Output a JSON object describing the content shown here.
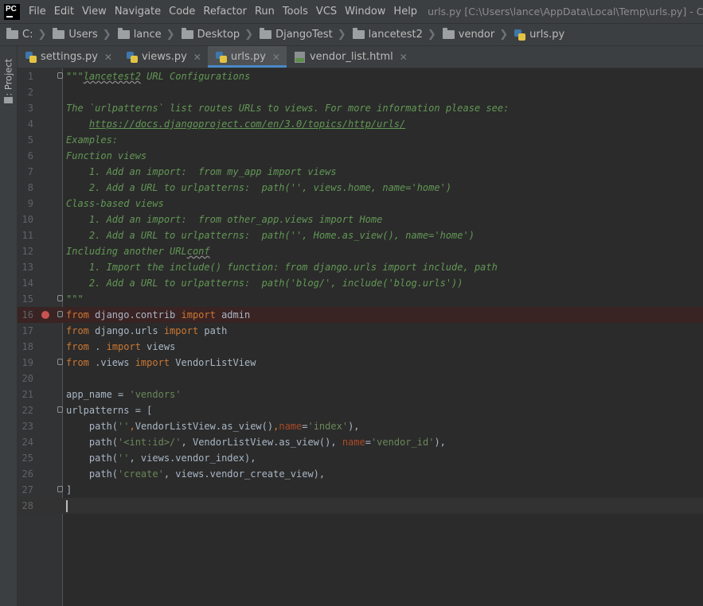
{
  "app": {
    "logo_text": "PC",
    "menu": [
      "File",
      "Edit",
      "View",
      "Navigate",
      "Code",
      "Refactor",
      "Run",
      "Tools",
      "VCS",
      "Window",
      "Help"
    ],
    "window_title": "urls.py [C:\\Users\\lance\\AppData\\Local\\Temp\\urls.py] - C:\\Users\\"
  },
  "breadcrumb": [
    "C:",
    "Users",
    "lance",
    "Desktop",
    "DjangoTest",
    "lancetest2",
    "vendor",
    "urls.py"
  ],
  "toolwindow": {
    "project_label": "1: Project"
  },
  "tabs": [
    {
      "label": "settings.py",
      "type": "py",
      "active": false
    },
    {
      "label": "views.py",
      "type": "py",
      "active": false
    },
    {
      "label": "urls.py",
      "type": "py",
      "active": true
    },
    {
      "label": "vendor_list.html",
      "type": "html",
      "active": false
    }
  ],
  "colors": {
    "keyword": "#cc7832",
    "string": "#6a8759",
    "docstring": "#629755",
    "param": "#aa4926",
    "breakpoint": "#c75450",
    "accent": "#4a88c7"
  },
  "editor": {
    "lines": [
      [
        {
          "t": "\"\"\"",
          "c": "doc"
        },
        {
          "t": "lancetest2",
          "c": "doc squig"
        },
        {
          "t": " URL Configurations",
          "c": "doc"
        }
      ],
      [],
      [
        {
          "t": "The `urlpatterns` list routes URLs to views. For more information please see:",
          "c": "doc"
        }
      ],
      [
        {
          "t": "    ",
          "c": "doc"
        },
        {
          "t": "https://docs.djangoproject.com/en/3.0/topics/http/urls/",
          "c": "doc link"
        }
      ],
      [
        {
          "t": "Examples:",
          "c": "doc"
        }
      ],
      [
        {
          "t": "Function views",
          "c": "doc"
        }
      ],
      [
        {
          "t": "    1. Add an import:  from my_app import views",
          "c": "doc"
        }
      ],
      [
        {
          "t": "    2. Add a URL to urlpatterns:  path('', views.home, name='home')",
          "c": "doc"
        }
      ],
      [
        {
          "t": "Class-based views",
          "c": "doc"
        }
      ],
      [
        {
          "t": "    1. Add an import:  from other_app.views import Home",
          "c": "doc"
        }
      ],
      [
        {
          "t": "    2. Add a URL to urlpatterns:  path('', Home.as_view(), name='home')",
          "c": "doc"
        }
      ],
      [
        {
          "t": "Including another URL",
          "c": "doc"
        },
        {
          "t": "conf",
          "c": "doc squig"
        }
      ],
      [
        {
          "t": "    1. Import the include() function: from django.urls import include, path",
          "c": "doc"
        }
      ],
      [
        {
          "t": "    2. Add a URL to urlpatterns:  path('blog/', include('blog.urls'))",
          "c": "doc"
        }
      ],
      [
        {
          "t": "\"\"\"",
          "c": "doc"
        }
      ],
      [
        {
          "t": "from",
          "c": "kw"
        },
        {
          "t": " django.contrib ",
          "c": ""
        },
        {
          "t": "import",
          "c": "kw"
        },
        {
          "t": " admin",
          "c": ""
        }
      ],
      [
        {
          "t": "from",
          "c": "kw"
        },
        {
          "t": " django.urls ",
          "c": ""
        },
        {
          "t": "import",
          "c": "kw"
        },
        {
          "t": " path",
          "c": ""
        }
      ],
      [
        {
          "t": "from",
          "c": "kw"
        },
        {
          "t": " . ",
          "c": ""
        },
        {
          "t": "import",
          "c": "kw"
        },
        {
          "t": " views",
          "c": ""
        }
      ],
      [
        {
          "t": "from",
          "c": "kw"
        },
        {
          "t": " .views ",
          "c": ""
        },
        {
          "t": "import",
          "c": "kw"
        },
        {
          "t": " VendorListView",
          "c": ""
        }
      ],
      [],
      [
        {
          "t": "app_name = ",
          "c": ""
        },
        {
          "t": "'vendors'",
          "c": "str"
        }
      ],
      [
        {
          "t": "urlpatterns = [",
          "c": ""
        }
      ],
      [
        {
          "t": "    path(",
          "c": ""
        },
        {
          "t": "''",
          "c": "str"
        },
        {
          "t": ",",
          "c": "kw"
        },
        {
          "t": "VendorListView.as_view()",
          "c": ""
        },
        {
          "t": ",",
          "c": "kw"
        },
        {
          "t": "name",
          "c": "param"
        },
        {
          "t": "=",
          "c": ""
        },
        {
          "t": "'index'",
          "c": "str"
        },
        {
          "t": "),",
          "c": ""
        }
      ],
      [
        {
          "t": "    path(",
          "c": ""
        },
        {
          "t": "'<int:id>/'",
          "c": "str"
        },
        {
          "t": ", VendorListView.as_view(), ",
          "c": ""
        },
        {
          "t": "name",
          "c": "param"
        },
        {
          "t": "=",
          "c": ""
        },
        {
          "t": "'vendor_id'",
          "c": "str"
        },
        {
          "t": "),",
          "c": ""
        }
      ],
      [
        {
          "t": "    path(",
          "c": ""
        },
        {
          "t": "''",
          "c": "str"
        },
        {
          "t": ", views.vendor_index),",
          "c": ""
        }
      ],
      [
        {
          "t": "    path(",
          "c": ""
        },
        {
          "t": "'create'",
          "c": "str"
        },
        {
          "t": ", views.vendor_create_view),",
          "c": ""
        }
      ],
      [
        {
          "t": "]",
          "c": ""
        }
      ],
      []
    ],
    "fold_lines": [
      1,
      15,
      16,
      19,
      22,
      27
    ],
    "breakpoint_line": 16,
    "caret_line": 28
  }
}
